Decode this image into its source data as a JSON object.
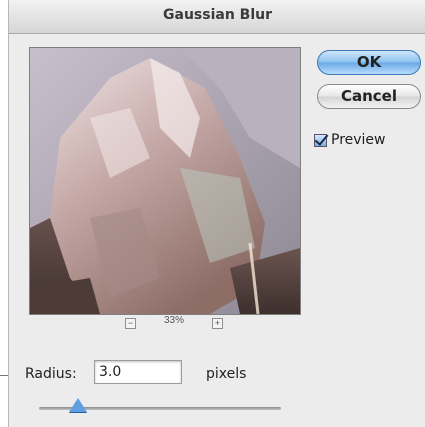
{
  "dialog": {
    "title": "Gaussian Blur",
    "ok_label": "OK",
    "cancel_label": "Cancel",
    "preview_checkbox": {
      "label": "Preview",
      "checked": true
    }
  },
  "preview_pane": {
    "zoom_out_glyph": "−",
    "zoom_in_glyph": "+",
    "zoom_level": "33%"
  },
  "radius": {
    "label": "Radius:",
    "value": "3.0",
    "unit": "pixels",
    "slider_fraction": 0.16
  },
  "colors": {
    "default_button": "#6aa9e6",
    "slider_thumb": "#5f9fe0"
  },
  "icons": {
    "checkbox": "checkmark-icon",
    "zoom_out": "minus-icon",
    "zoom_in": "plus-icon",
    "slider": "triangle-thumb-icon"
  }
}
